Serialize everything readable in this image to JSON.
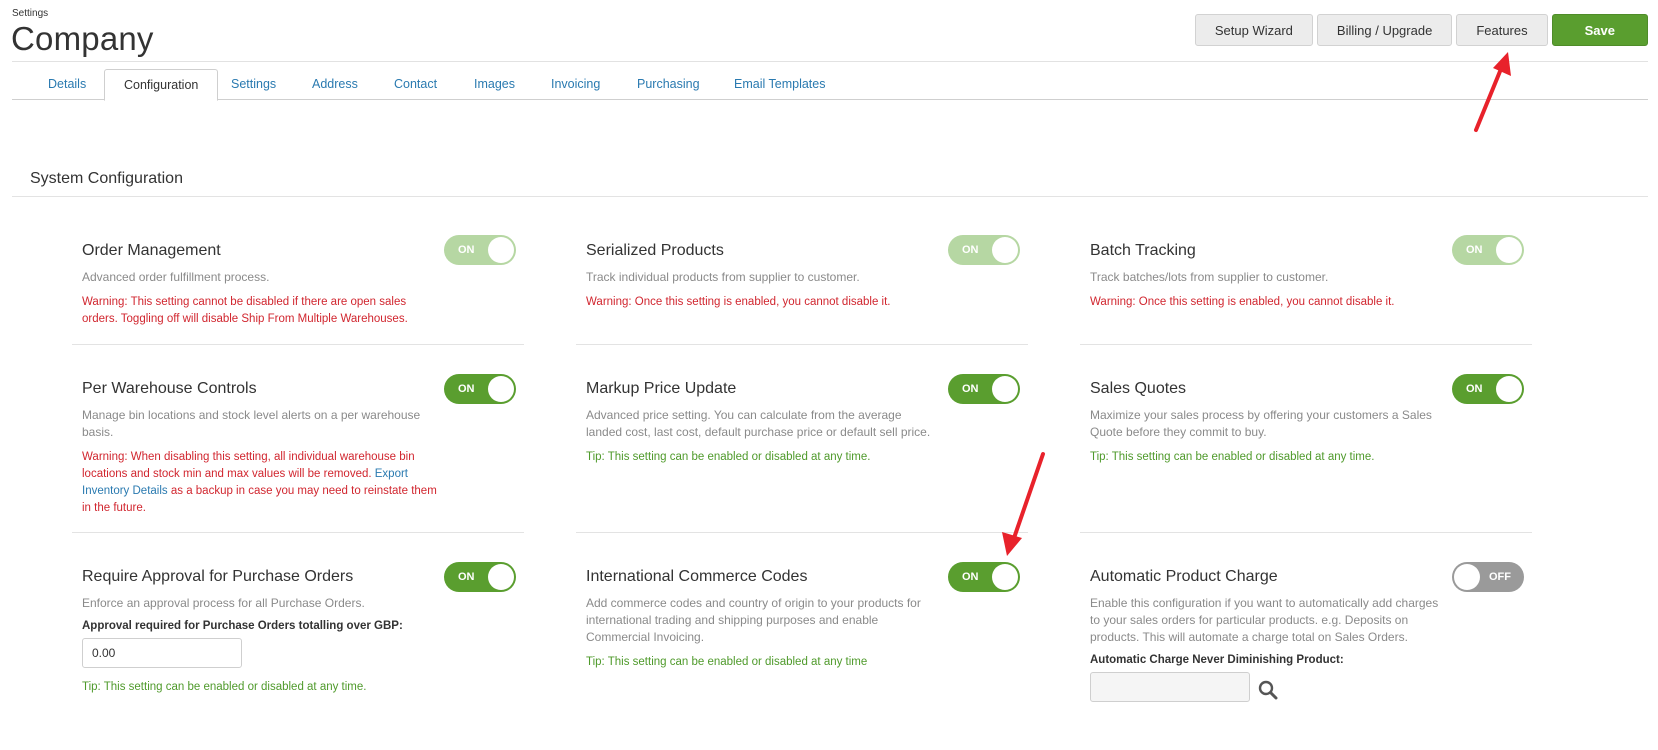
{
  "header": {
    "breadcrumb": "Settings",
    "title": "Company",
    "actions": {
      "setup_wizard": "Setup Wizard",
      "billing": "Billing / Upgrade",
      "features": "Features",
      "save": "Save"
    }
  },
  "tabs": [
    "Details",
    "Configuration",
    "Settings",
    "Address",
    "Contact",
    "Images",
    "Invoicing",
    "Purchasing",
    "Email Templates"
  ],
  "active_tab": "Configuration",
  "section": {
    "title": "System Configuration"
  },
  "colors": {
    "accent": "#5a9e2f",
    "warning": "#d1262f",
    "tip": "#4f9a2b",
    "link": "#2a7ab0"
  },
  "cards": {
    "order_management": {
      "title": "Order Management",
      "toggle": "ON",
      "desc": "Advanced order fulfillment process.",
      "warn_label": "Warning:",
      "warn_text": " This setting cannot be disabled if there are open sales orders. Toggling off will disable Ship From Multiple Warehouses."
    },
    "serialized_products": {
      "title": "Serialized Products",
      "toggle": "ON",
      "desc": "Track individual products from supplier to customer.",
      "warn_label": "Warning:",
      "warn_text": " Once this setting is enabled, you cannot disable it."
    },
    "batch_tracking": {
      "title": "Batch Tracking",
      "toggle": "ON",
      "desc": "Track batches/lots from supplier to customer.",
      "warn_label": "Warning:",
      "warn_text": " Once this setting is enabled, you cannot disable it."
    },
    "per_warehouse": {
      "title": "Per Warehouse Controls",
      "toggle": "ON",
      "desc": "Manage bin locations and stock level alerts on a per warehouse basis.",
      "warn_label": "Warning:",
      "warn_text": " When disabling this setting, all individual warehouse bin locations and stock min and max values will be removed. ",
      "warn_link": "Export Inventory Details",
      "warn_text2": " as a backup in case you may need to reinstate them in the future."
    },
    "markup_price": {
      "title": "Markup Price Update",
      "toggle": "ON",
      "desc": "Advanced price setting. You can calculate from the average landed cost, last cost, default purchase price or default sell price.",
      "tip_label": "Tip:",
      "tip_text": " This setting can be enabled or disabled at any time."
    },
    "sales_quotes": {
      "title": "Sales Quotes",
      "toggle": "ON",
      "desc": "Maximize your sales process by offering your customers a Sales Quote before they commit to buy.",
      "tip_label": "Tip:",
      "tip_text": " This setting can be enabled or disabled at any time."
    },
    "require_approval": {
      "title": "Require Approval for Purchase Orders",
      "toggle": "ON",
      "desc": "Enforce an approval process for all Purchase Orders.",
      "field_label": "Approval required for Purchase Orders totalling over GBP:",
      "field_value": "0.00",
      "tip_label": "Tip:",
      "tip_text": " This setting can be enabled or disabled at any time."
    },
    "commerce_codes": {
      "title": "International Commerce Codes",
      "toggle": "ON",
      "desc": "Add commerce codes and country of origin to your products for international trading and shipping purposes and enable Commercial Invoicing.",
      "tip_label": "Tip:",
      "tip_text": " This setting can be enabled or disabled at any time"
    },
    "auto_charge": {
      "title": "Automatic Product Charge",
      "toggle": "OFF",
      "desc": "Enable this configuration if you want to automatically add charges to your sales orders for particular products. e.g. Deposits on products. This will automate a charge total on Sales Orders.",
      "field_label": "Automatic Charge Never Diminishing Product:",
      "field_value": ""
    }
  }
}
